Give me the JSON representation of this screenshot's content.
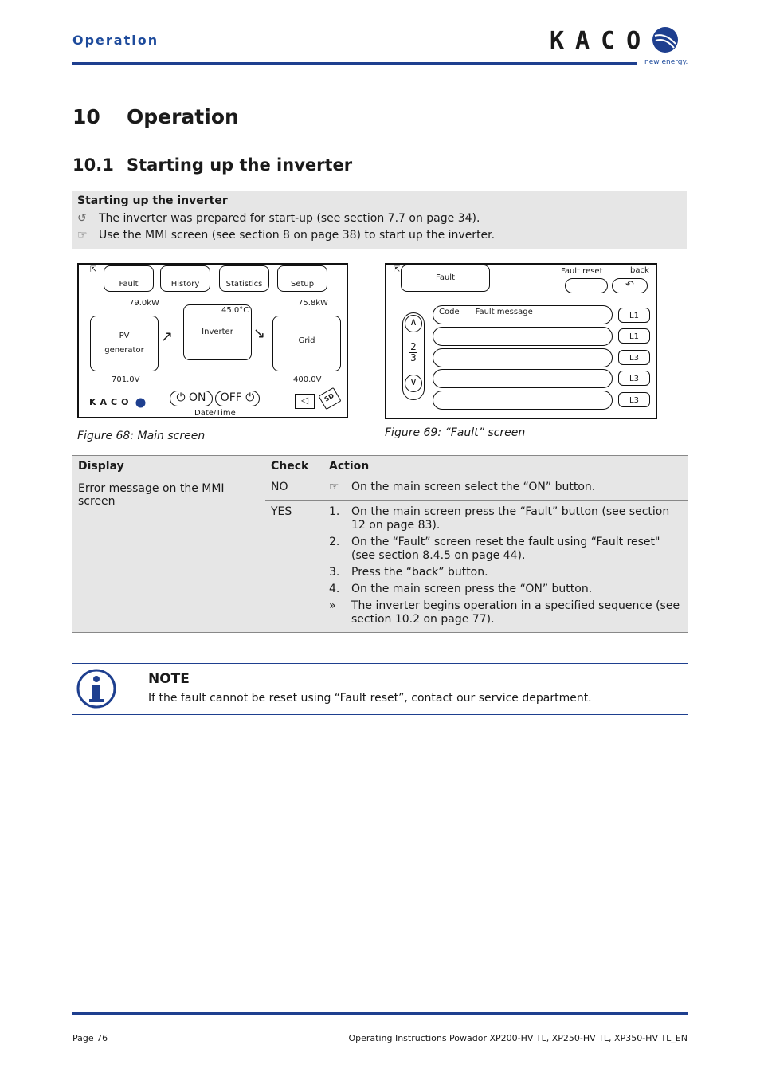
{
  "header": {
    "section": "Operation",
    "logo": "KACO",
    "tagline": "new energy.",
    "accent": "#1e3f8f"
  },
  "chapter": {
    "num": "10",
    "title": "Operation"
  },
  "section": {
    "num": "10.1",
    "title": "Starting up the inverter"
  },
  "instruction": {
    "title": "Starting up the inverter",
    "items": [
      {
        "icon": "prerequisite-icon",
        "glyph": "↺",
        "text": "The inverter was prepared for start-up (see section 7.7 on page 34)."
      },
      {
        "icon": "hand-pointer-icon",
        "glyph": "☞",
        "text": "Use the MMI screen (see section 8 on page 38) to start up the inverter."
      }
    ]
  },
  "fig68": {
    "buttons": [
      "Fault",
      "History",
      "Statistics",
      "Setup"
    ],
    "pv_power": "79.0kW",
    "grid_power": "75.8kW",
    "temp": "45.0°C",
    "pv": "PV",
    "pv2": "generator",
    "inverter": "Inverter",
    "grid": "Grid",
    "pv_voltage": "701.0V",
    "grid_voltage": "400.0V",
    "on": "ON",
    "off": "OFF",
    "datetime": "Date/Time",
    "logo": "KACO",
    "sd": "SD",
    "caption": "Figure 68: Main screen"
  },
  "fig69": {
    "fault": "Fault",
    "fault_reset": "Fault reset",
    "back": "back",
    "code": "Code",
    "fault_message": "Fault message",
    "page_num": "2",
    "page_den": "3",
    "levels": [
      "L1",
      "L1",
      "L3",
      "L3",
      "L3"
    ],
    "caption": "Figure 69: “Fault” screen"
  },
  "table": {
    "headers": [
      "Display",
      "Check",
      "Action"
    ],
    "display": "Error message on the MMI screen",
    "rows": [
      {
        "check": "NO",
        "actions": [
          {
            "n": "☞",
            "text": "On the main screen select the “ON” button."
          }
        ]
      },
      {
        "check": "YES",
        "actions": [
          {
            "n": "1.",
            "text": "On the main screen press the “Fault” button (see section 12 on page 83)."
          },
          {
            "n": "2.",
            "text": "On the “Fault” screen reset the fault using “Fault reset\" (see section 8.4.5 on page 44)."
          },
          {
            "n": "3.",
            "text": "Press the “back” button."
          },
          {
            "n": "4.",
            "text": "On the main screen press the “ON” button."
          },
          {
            "n": "»",
            "text": "The inverter begins operation in a specified sequence (see section 10.2 on page 77)."
          }
        ]
      }
    ]
  },
  "note": {
    "title": "NOTE",
    "text": "If the fault cannot be reset using “Fault reset”, contact our service department."
  },
  "footer": {
    "page": "Page 76",
    "doc": "Operating Instructions Powador XP200-HV TL, XP250-HV TL, XP350-HV TL_EN"
  }
}
